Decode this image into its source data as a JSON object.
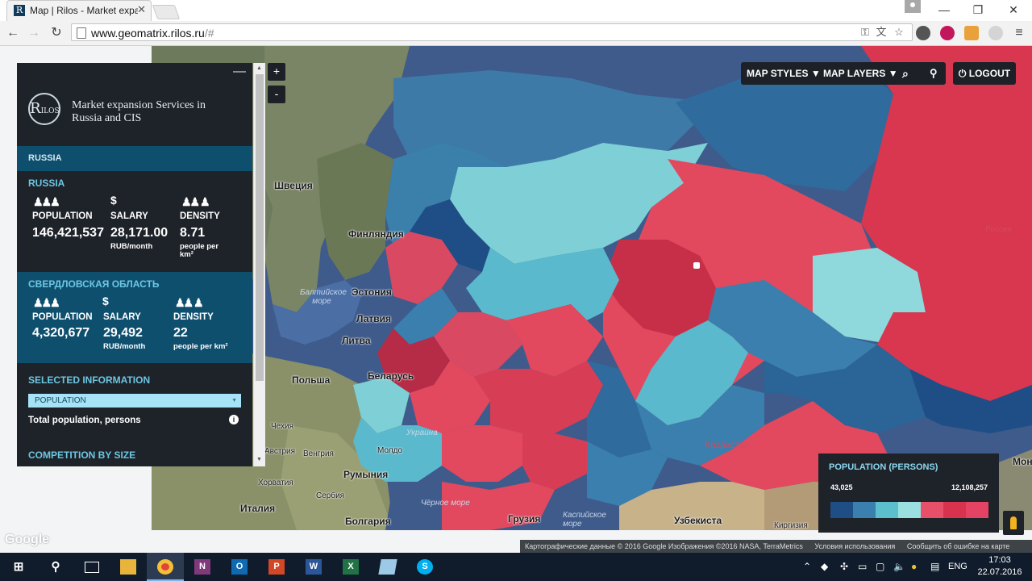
{
  "browser": {
    "tab_title": "Map | Rilos - Market expa",
    "url_host": "www.geomatrix.rilos.ru",
    "url_rest": "/#"
  },
  "panel": {
    "logo_text": "Market expansion Services in Russia and CIS",
    "logo_mark": "R",
    "logo_mark_small": "ILOS",
    "breadcrumb": "RUSSIA",
    "country": {
      "title": "RUSSIA",
      "population_label": "POPULATION",
      "population_value": "146,421,537",
      "salary_label": "SALARY",
      "salary_value": "28,171.00",
      "salary_unit": "RUB/month",
      "density_label": "DENSITY",
      "density_value": "8.71",
      "density_unit": "people per km²"
    },
    "region": {
      "title": "СВЕРДЛОВСКАЯ ОБЛАСТЬ",
      "population_label": "POPULATION",
      "population_value": "4,320,677",
      "salary_label": "SALARY",
      "salary_value": "29,492",
      "salary_unit": "RUB/month",
      "density_label": "DENSITY",
      "density_value": "22",
      "density_unit": "people per km²"
    },
    "selected_info_title": "SELECTED INFORMATION",
    "selected_option": "POPULATION",
    "info_text": "Total population, persons",
    "competition_title": "COMPETITION BY SIZE"
  },
  "map_controls": {
    "zoom_in": "+",
    "zoom_out": "-",
    "map_styles": "MAP STYLES",
    "map_layers": "MAP LAYERS",
    "logout": "LOGOUT"
  },
  "map_labels": {
    "sweden": "Швеция",
    "finland": "Финляндия",
    "estonia": "Эстония",
    "latvia": "Латвия",
    "lithuania": "Литва",
    "poland": "Польша",
    "belarus": "Беларусь",
    "czech": "Чехия",
    "austria": "Австрия",
    "hungary": "Венгрия",
    "romania": "Румыния",
    "croatia": "Хорватия",
    "serbia": "Сербия",
    "italy": "Италия",
    "bulgaria": "Болгария",
    "georgia": "Грузия",
    "uzbekistan": "Узбекиста",
    "kazakhstan": "Казахстан",
    "russia": "Россия",
    "baltic_sea": "Балтийское море",
    "black_sea": "Чёрное море",
    "caspian_sea": "Каспийское море",
    "kyrgyzstan": "Киргизия",
    "mongolia": "Мон",
    "moldova": "Молдо",
    "ukraine": "Украина"
  },
  "legend": {
    "title": "POPULATION (PERSONS)",
    "min": "43,025",
    "max": "12,108,257",
    "colors": [
      "#1f4e86",
      "#3a7fad",
      "#5bbfce",
      "#9be0e0",
      "#e8506a",
      "#d8334e",
      "#e44363"
    ]
  },
  "attribution": {
    "data": "Картографические данные © 2016 Google Изображения ©2016 NASA, TerraMetrics",
    "terms": "Условия использования",
    "report": "Сообщить об ошибке на карте"
  },
  "google": "Google",
  "taskbar": {
    "lang": "ENG",
    "time": "17:03",
    "date": "22.07.2016"
  }
}
